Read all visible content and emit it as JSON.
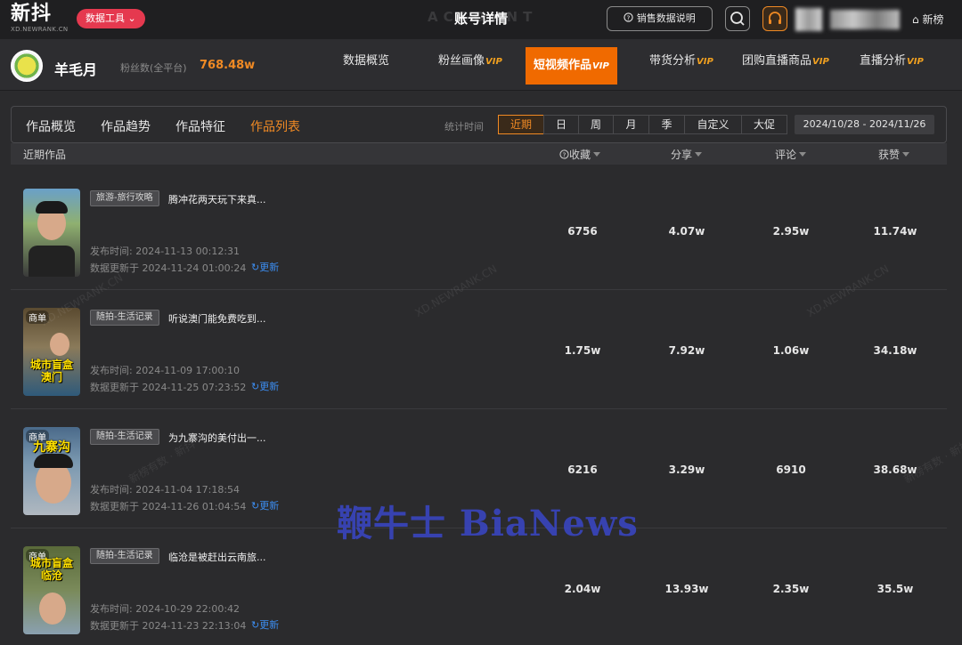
{
  "brand": {
    "name": "新抖",
    "domain": "XD.NEWRANK.CN"
  },
  "topbar": {
    "tools_label": "数据工具",
    "page_title": "账号详情",
    "title_ghost": "ACCOUNT",
    "sales_help_label": "销售数据说明",
    "newbang_label": "新榜"
  },
  "account": {
    "name": "羊毛月",
    "fans_label": "粉丝数(全平台)",
    "fans_value": "768.48w",
    "nav": [
      {
        "label": "数据概览",
        "vip": ""
      },
      {
        "label": "粉丝画像",
        "vip": "VIP"
      },
      {
        "label": "短视频作品",
        "vip": "VIP"
      },
      {
        "label": "带货分析",
        "vip": "VIP"
      },
      {
        "label": "团购直播商品",
        "vip": "VIP"
      },
      {
        "label": "直播分析",
        "vip": "VIP"
      }
    ]
  },
  "subtabs": [
    "作品概览",
    "作品趋势",
    "作品特征",
    "作品列表"
  ],
  "stat_time_label": "统计时间",
  "periods": [
    "近期",
    "日",
    "周",
    "月",
    "季",
    "自定义",
    "大促"
  ],
  "date_range": "2024/10/28 - 2024/11/26",
  "table": {
    "headers": {
      "works": "近期作品",
      "collect": "收藏",
      "share": "分享",
      "comment": "评论",
      "likes": "获赞"
    },
    "rows": [
      {
        "tag": "旅游-旅行攻略",
        "title": "腾冲花两天玩下来真...",
        "ad": "",
        "caption": "",
        "published": "发布时间: 2024-11-13 00:12:31",
        "updated": "数据更新于 2024-11-24 01:00:24",
        "collect": "6756",
        "share": "4.07w",
        "comment": "2.95w",
        "likes": "11.74w"
      },
      {
        "tag": "随拍-生活记录",
        "title": "听说澳门能免费吃到...",
        "ad": "商单",
        "caption": "城市盲盒 澳门",
        "published": "发布时间: 2024-11-09 17:00:10",
        "updated": "数据更新于 2024-11-25 07:23:52",
        "collect": "1.75w",
        "share": "7.92w",
        "comment": "1.06w",
        "likes": "34.18w"
      },
      {
        "tag": "随拍-生活记录",
        "title": "为九寨沟的美付出一...",
        "ad": "商单",
        "caption": "九寨沟",
        "published": "发布时间: 2024-11-04 17:18:54",
        "updated": "数据更新于 2024-11-26 01:04:54",
        "collect": "6216",
        "share": "3.29w",
        "comment": "6910",
        "likes": "38.68w"
      },
      {
        "tag": "随拍-生活记录",
        "title": "临沧是被赶出云南旅...",
        "ad": "商单",
        "caption": "城市盲盒 临沧",
        "published": "发布时间: 2024-10-29 22:00:42",
        "updated": "数据更新于 2024-11-23 22:13:04",
        "collect": "2.04w",
        "share": "13.93w",
        "comment": "2.35w",
        "likes": "35.5w"
      }
    ],
    "refresh_label": "更新"
  },
  "watermarks": {
    "domain": "XD.NEWRANK.CN",
    "cn": "新榜有数 · 新抖",
    "overlay": "鞭牛士 BiaNews"
  }
}
